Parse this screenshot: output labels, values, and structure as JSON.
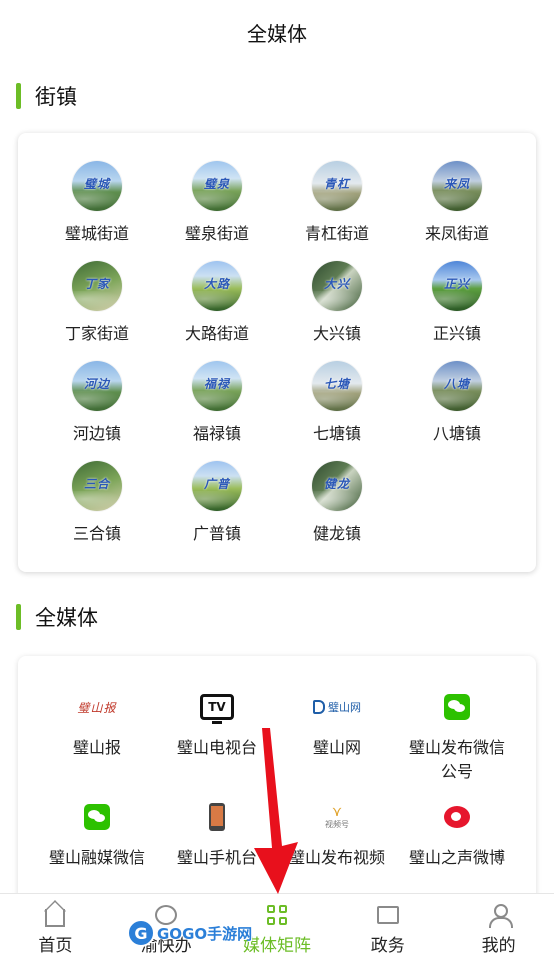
{
  "header": {
    "title": "全媒体"
  },
  "sections": {
    "towns": {
      "title": "街镇"
    },
    "media": {
      "title": "全媒体"
    }
  },
  "towns": [
    {
      "label": "璧城街道",
      "calligraphy": "璧城"
    },
    {
      "label": "璧泉街道",
      "calligraphy": "璧泉"
    },
    {
      "label": "青杠街道",
      "calligraphy": "青杠"
    },
    {
      "label": "来凤街道",
      "calligraphy": "来凤"
    },
    {
      "label": "丁家街道",
      "calligraphy": "丁家"
    },
    {
      "label": "大路街道",
      "calligraphy": "大路"
    },
    {
      "label": "大兴镇",
      "calligraphy": "大兴"
    },
    {
      "label": "正兴镇",
      "calligraphy": "正兴"
    },
    {
      "label": "河边镇",
      "calligraphy": "河边"
    },
    {
      "label": "福禄镇",
      "calligraphy": "福禄"
    },
    {
      "label": "七塘镇",
      "calligraphy": "七塘"
    },
    {
      "label": "八塘镇",
      "calligraphy": "八塘"
    },
    {
      "label": "三合镇",
      "calligraphy": "三合"
    },
    {
      "label": "广普镇",
      "calligraphy": "广普"
    },
    {
      "label": "健龙镇",
      "calligraphy": "健龙"
    }
  ],
  "media": [
    {
      "label": "璧山报",
      "icon": "newspaper-logo-icon",
      "logo_text": "璧山报"
    },
    {
      "label": "璧山电视台",
      "icon": "tv-icon",
      "logo_text": "TV"
    },
    {
      "label": "璧山网",
      "icon": "website-logo-icon",
      "logo_text": "璧山网"
    },
    {
      "label": "璧山发布微信公号",
      "icon": "wechat-icon"
    },
    {
      "label": "璧山融媒微信",
      "icon": "wechat-icon"
    },
    {
      "label": "璧山手机台",
      "icon": "phone-icon"
    },
    {
      "label": "璧山发布视频",
      "icon": "video-channel-icon",
      "logo_text": "视频号"
    },
    {
      "label": "璧山之声微博",
      "icon": "weibo-icon"
    }
  ],
  "tabbar": {
    "tabs": [
      {
        "label": "首页",
        "icon": "home-icon",
        "active": false
      },
      {
        "label": "渝快办",
        "icon": "chat-icon",
        "active": false
      },
      {
        "label": "媒体矩阵",
        "icon": "grid-icon",
        "active": true
      },
      {
        "label": "政务",
        "icon": "news-icon",
        "active": false
      },
      {
        "label": "我的",
        "icon": "user-icon",
        "active": false
      }
    ]
  },
  "watermark": {
    "text": "GOGO手游网"
  },
  "colors": {
    "accent": "#6cbd26",
    "arrow": "#e8101c"
  }
}
